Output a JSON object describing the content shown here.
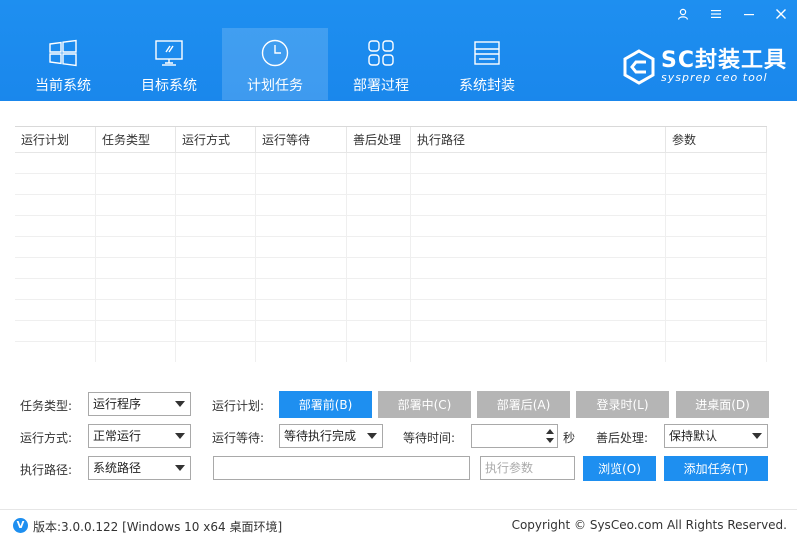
{
  "window": {
    "controls": {
      "user_icon": "user-icon",
      "menu_icon": "menu-icon",
      "minimize_icon": "minimize-icon",
      "close_icon": "close-icon"
    }
  },
  "nav": {
    "items": [
      {
        "label": "当前系统",
        "icon": "windows-icon"
      },
      {
        "label": "目标系统",
        "icon": "monitor-icon"
      },
      {
        "label": "计划任务",
        "icon": "clock-icon",
        "active": true
      },
      {
        "label": "部署过程",
        "icon": "grid-icon"
      },
      {
        "label": "系统封装",
        "icon": "drive-icon"
      }
    ]
  },
  "logo": {
    "title": "SC封装工具",
    "subtitle": "sysprep ceo tool"
  },
  "table": {
    "columns": [
      "运行计划",
      "任务类型",
      "运行方式",
      "运行等待",
      "善后处理",
      "执行路径",
      "参数"
    ]
  },
  "form": {
    "task_type": {
      "label": "任务类型:",
      "value": "运行程序"
    },
    "run_mode": {
      "label": "运行方式:",
      "value": "正常运行"
    },
    "exec_path": {
      "label": "执行路径:",
      "value": "系统路径"
    },
    "run_plan": {
      "label": "运行计划:"
    },
    "run_wait": {
      "label": "运行等待:",
      "value": "等待执行完成"
    },
    "wait_time": {
      "label": "等待时间:",
      "value": "",
      "unit": "秒"
    },
    "after_process": {
      "label": "善后处理:",
      "value": "保持默认"
    },
    "path_input": {
      "value": ""
    },
    "params_input": {
      "placeholder": "执行参数"
    },
    "plan_buttons": [
      "部署前(B)",
      "部署中(C)",
      "部署后(A)",
      "登录时(L)",
      "进桌面(D)"
    ],
    "browse_button": "浏览(O)",
    "add_task_button": "添加任务(T)"
  },
  "footer": {
    "badge": "V",
    "version": "版本:3.0.0.122 [Windows 10 x64 桌面环境]",
    "copyright": "Copyright © SysCeo.com All Rights Reserved."
  },
  "colors": {
    "primary": "#1e8ff0",
    "inactive_button": "#b5b5b5"
  }
}
